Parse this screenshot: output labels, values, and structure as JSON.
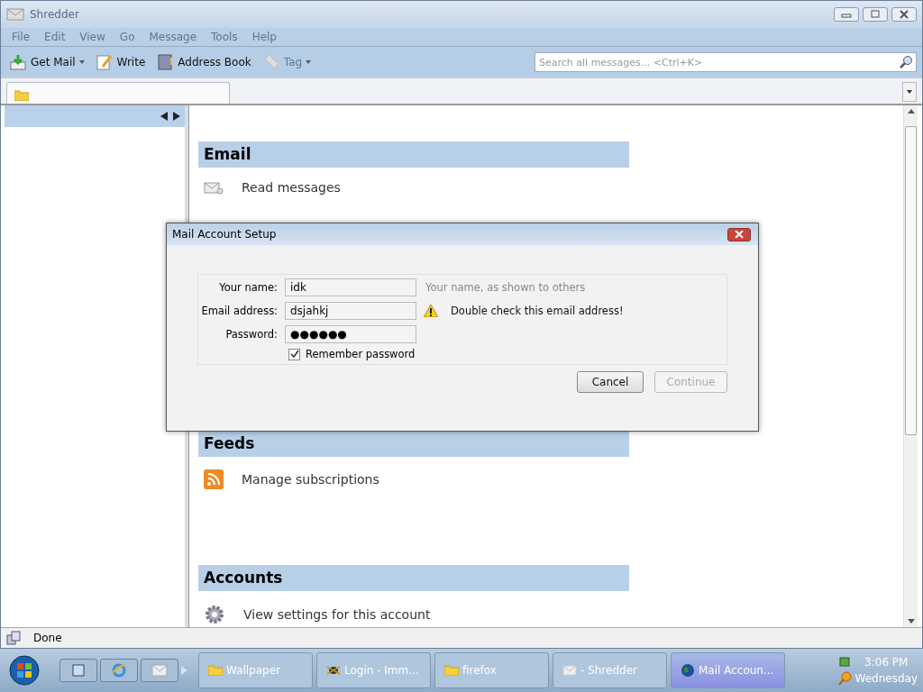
{
  "window": {
    "title": "Shredder"
  },
  "menu": [
    {
      "label": "File",
      "disabled": true
    },
    {
      "label": "Edit",
      "disabled": true
    },
    {
      "label": "View",
      "disabled": true
    },
    {
      "label": "Go",
      "disabled": true
    },
    {
      "label": "Message",
      "disabled": true
    },
    {
      "label": "Tools",
      "disabled": true
    },
    {
      "label": "Help",
      "disabled": true
    }
  ],
  "toolbar": [
    {
      "label": "Get Mail",
      "kind": "getmail",
      "dropdown": true,
      "disabled": false
    },
    {
      "label": "Write",
      "kind": "write",
      "dropdown": false,
      "disabled": false
    },
    {
      "label": "Address Book",
      "kind": "book",
      "dropdown": false,
      "disabled": false
    },
    {
      "label": "Tag",
      "kind": "tag",
      "dropdown": true,
      "disabled": true
    }
  ],
  "search": {
    "placeholder": "Search all messages... <Ctrl+K>"
  },
  "sections": [
    {
      "title": "Email",
      "items": [
        {
          "label": "Read messages",
          "kind": "mail"
        }
      ]
    },
    {
      "title": "Feeds",
      "items": [
        {
          "label": "Manage subscriptions",
          "kind": "rss"
        }
      ]
    },
    {
      "title": "Accounts",
      "items": [
        {
          "label": "View settings for this account",
          "kind": "gear"
        }
      ]
    }
  ],
  "dialog": {
    "title": "Mail Account Setup",
    "fields": [
      {
        "label": "Your name:",
        "value": "idk",
        "hint": "Your name, as shown to others",
        "warning": false
      },
      {
        "label": "Email address:",
        "value": "dsjahkj",
        "hint": "Double check this email address!",
        "warning": true
      },
      {
        "label": "Password:",
        "value": "●●●●●●",
        "warning": false
      }
    ],
    "remember": {
      "label": "Remember password",
      "checked": true
    },
    "buttons": [
      {
        "label": "Cancel",
        "disabled": false
      },
      {
        "label": "Continue",
        "disabled": true
      }
    ]
  },
  "status_bar": {
    "text": "Done"
  },
  "taskbar": {
    "windows": [
      {
        "label": "Wallpaper",
        "kind": "folder",
        "selected": false
      },
      {
        "label": "Login - Imm...",
        "kind": "app",
        "selected": false
      },
      {
        "label": "firefox",
        "kind": "folder",
        "selected": false
      },
      {
        "label": "- Shredder",
        "kind": "mail",
        "selected": false
      },
      {
        "label": "Mail Accoun...",
        "kind": "globe",
        "selected": true
      }
    ],
    "clock": {
      "time": "3:06 PM",
      "day": "Wednesday"
    }
  }
}
